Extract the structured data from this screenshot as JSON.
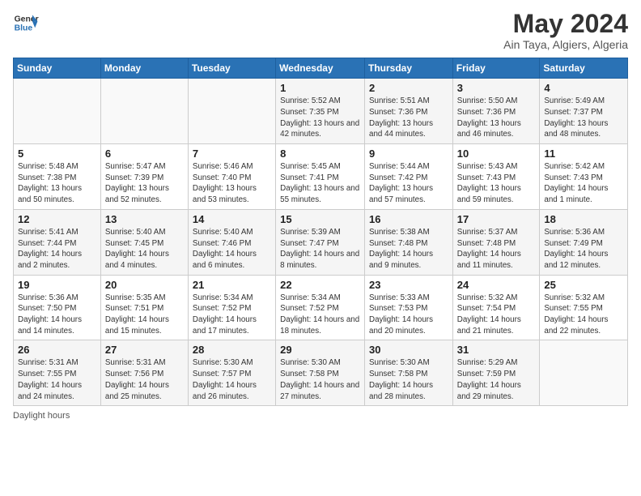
{
  "logo": {
    "line1": "General",
    "line2": "Blue"
  },
  "title": "May 2024",
  "subtitle": "Ain Taya, Algiers, Algeria",
  "days_header": [
    "Sunday",
    "Monday",
    "Tuesday",
    "Wednesday",
    "Thursday",
    "Friday",
    "Saturday"
  ],
  "weeks": [
    [
      {
        "day": "",
        "info": ""
      },
      {
        "day": "",
        "info": ""
      },
      {
        "day": "",
        "info": ""
      },
      {
        "day": "1",
        "info": "Sunrise: 5:52 AM\nSunset: 7:35 PM\nDaylight: 13 hours\nand 42 minutes."
      },
      {
        "day": "2",
        "info": "Sunrise: 5:51 AM\nSunset: 7:36 PM\nDaylight: 13 hours\nand 44 minutes."
      },
      {
        "day": "3",
        "info": "Sunrise: 5:50 AM\nSunset: 7:36 PM\nDaylight: 13 hours\nand 46 minutes."
      },
      {
        "day": "4",
        "info": "Sunrise: 5:49 AM\nSunset: 7:37 PM\nDaylight: 13 hours\nand 48 minutes."
      }
    ],
    [
      {
        "day": "5",
        "info": "Sunrise: 5:48 AM\nSunset: 7:38 PM\nDaylight: 13 hours\nand 50 minutes."
      },
      {
        "day": "6",
        "info": "Sunrise: 5:47 AM\nSunset: 7:39 PM\nDaylight: 13 hours\nand 52 minutes."
      },
      {
        "day": "7",
        "info": "Sunrise: 5:46 AM\nSunset: 7:40 PM\nDaylight: 13 hours\nand 53 minutes."
      },
      {
        "day": "8",
        "info": "Sunrise: 5:45 AM\nSunset: 7:41 PM\nDaylight: 13 hours\nand 55 minutes."
      },
      {
        "day": "9",
        "info": "Sunrise: 5:44 AM\nSunset: 7:42 PM\nDaylight: 13 hours\nand 57 minutes."
      },
      {
        "day": "10",
        "info": "Sunrise: 5:43 AM\nSunset: 7:43 PM\nDaylight: 13 hours\nand 59 minutes."
      },
      {
        "day": "11",
        "info": "Sunrise: 5:42 AM\nSunset: 7:43 PM\nDaylight: 14 hours\nand 1 minute."
      }
    ],
    [
      {
        "day": "12",
        "info": "Sunrise: 5:41 AM\nSunset: 7:44 PM\nDaylight: 14 hours\nand 2 minutes."
      },
      {
        "day": "13",
        "info": "Sunrise: 5:40 AM\nSunset: 7:45 PM\nDaylight: 14 hours\nand 4 minutes."
      },
      {
        "day": "14",
        "info": "Sunrise: 5:40 AM\nSunset: 7:46 PM\nDaylight: 14 hours\nand 6 minutes."
      },
      {
        "day": "15",
        "info": "Sunrise: 5:39 AM\nSunset: 7:47 PM\nDaylight: 14 hours\nand 8 minutes."
      },
      {
        "day": "16",
        "info": "Sunrise: 5:38 AM\nSunset: 7:48 PM\nDaylight: 14 hours\nand 9 minutes."
      },
      {
        "day": "17",
        "info": "Sunrise: 5:37 AM\nSunset: 7:48 PM\nDaylight: 14 hours\nand 11 minutes."
      },
      {
        "day": "18",
        "info": "Sunrise: 5:36 AM\nSunset: 7:49 PM\nDaylight: 14 hours\nand 12 minutes."
      }
    ],
    [
      {
        "day": "19",
        "info": "Sunrise: 5:36 AM\nSunset: 7:50 PM\nDaylight: 14 hours\nand 14 minutes."
      },
      {
        "day": "20",
        "info": "Sunrise: 5:35 AM\nSunset: 7:51 PM\nDaylight: 14 hours\nand 15 minutes."
      },
      {
        "day": "21",
        "info": "Sunrise: 5:34 AM\nSunset: 7:52 PM\nDaylight: 14 hours\nand 17 minutes."
      },
      {
        "day": "22",
        "info": "Sunrise: 5:34 AM\nSunset: 7:52 PM\nDaylight: 14 hours\nand 18 minutes."
      },
      {
        "day": "23",
        "info": "Sunrise: 5:33 AM\nSunset: 7:53 PM\nDaylight: 14 hours\nand 20 minutes."
      },
      {
        "day": "24",
        "info": "Sunrise: 5:32 AM\nSunset: 7:54 PM\nDaylight: 14 hours\nand 21 minutes."
      },
      {
        "day": "25",
        "info": "Sunrise: 5:32 AM\nSunset: 7:55 PM\nDaylight: 14 hours\nand 22 minutes."
      }
    ],
    [
      {
        "day": "26",
        "info": "Sunrise: 5:31 AM\nSunset: 7:55 PM\nDaylight: 14 hours\nand 24 minutes."
      },
      {
        "day": "27",
        "info": "Sunrise: 5:31 AM\nSunset: 7:56 PM\nDaylight: 14 hours\nand 25 minutes."
      },
      {
        "day": "28",
        "info": "Sunrise: 5:30 AM\nSunset: 7:57 PM\nDaylight: 14 hours\nand 26 minutes."
      },
      {
        "day": "29",
        "info": "Sunrise: 5:30 AM\nSunset: 7:58 PM\nDaylight: 14 hours\nand 27 minutes."
      },
      {
        "day": "30",
        "info": "Sunrise: 5:30 AM\nSunset: 7:58 PM\nDaylight: 14 hours\nand 28 minutes."
      },
      {
        "day": "31",
        "info": "Sunrise: 5:29 AM\nSunset: 7:59 PM\nDaylight: 14 hours\nand 29 minutes."
      },
      {
        "day": "",
        "info": ""
      }
    ]
  ],
  "footer": "Daylight hours"
}
